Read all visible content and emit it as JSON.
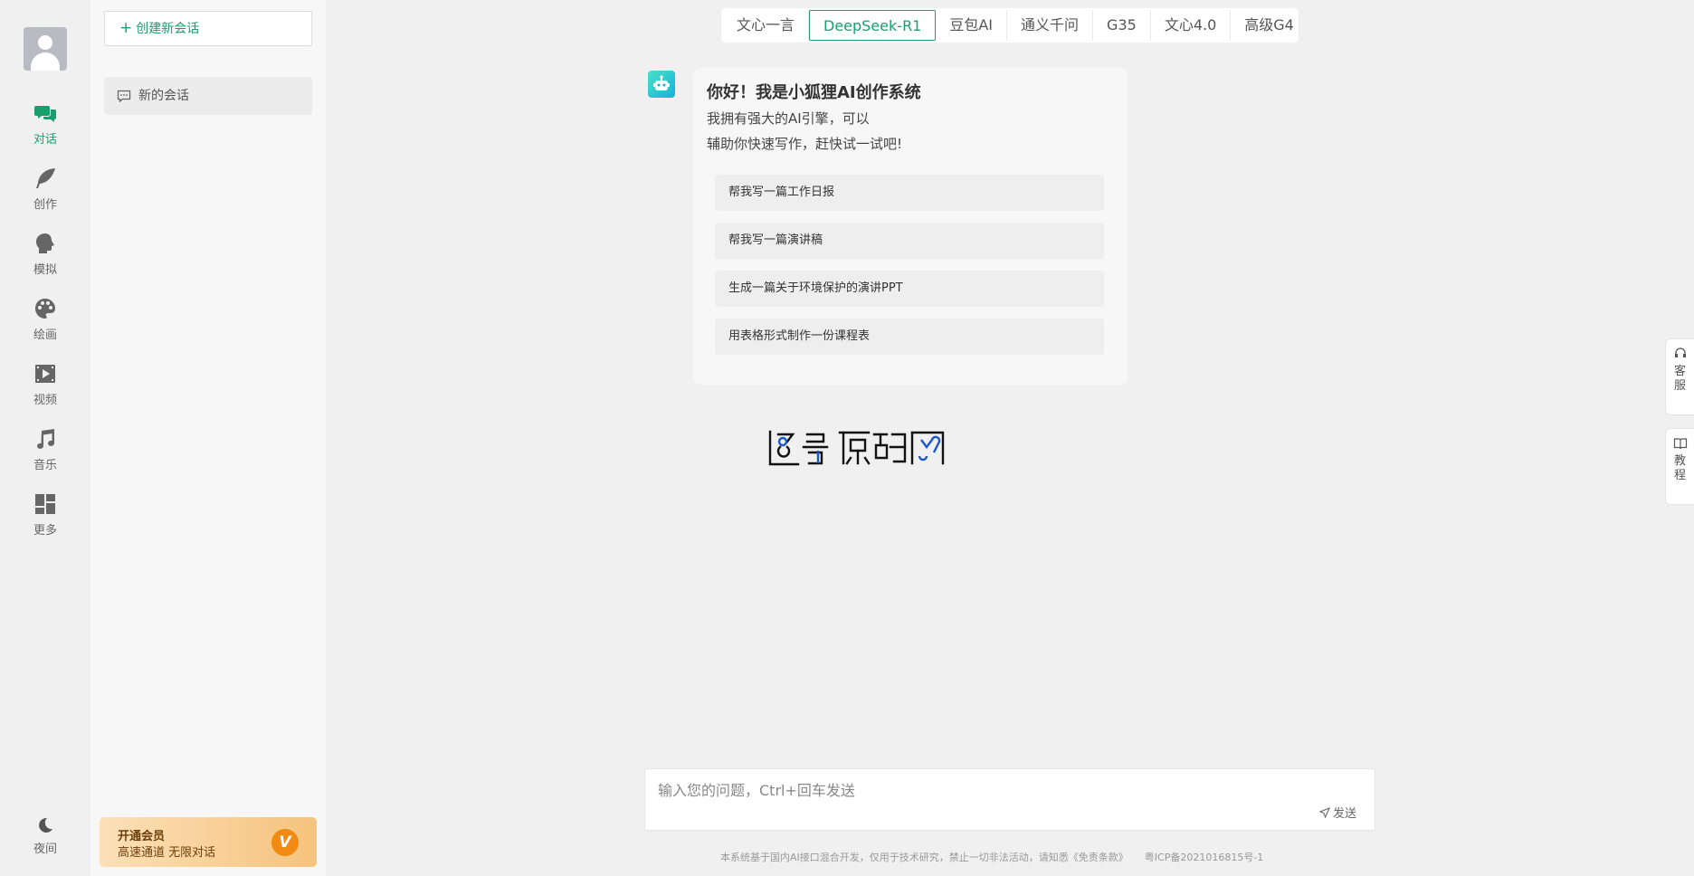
{
  "rail": {
    "items": [
      {
        "label": "对话",
        "icon": "chat-icon"
      },
      {
        "label": "创作",
        "icon": "feather-icon"
      },
      {
        "label": "模拟",
        "icon": "head-icon"
      },
      {
        "label": "绘画",
        "icon": "palette-icon"
      },
      {
        "label": "视频",
        "icon": "video-icon"
      },
      {
        "label": "音乐",
        "icon": "music-icon"
      },
      {
        "label": "更多",
        "icon": "grid-icon"
      }
    ],
    "night_label": "夜间"
  },
  "sidebar": {
    "new_chat_label": "创建新会话",
    "conversations": [
      {
        "title": "新的会话"
      }
    ],
    "member": {
      "title": "开通会员",
      "subtitle": "高速通道 无限对话",
      "badge": "V"
    }
  },
  "models": {
    "tabs": [
      "文心一言",
      "DeepSeek-R1",
      "豆包AI",
      "通义千问",
      "G35",
      "文心4.0",
      "高级G4"
    ],
    "active": "DeepSeek-R1"
  },
  "welcome": {
    "title": "你好！我是小狐狸AI创作系统",
    "line1": "我拥有强大的AI引擎，可以",
    "line2": "辅助你快速写作，赶快试一试吧!",
    "prompts": [
      "帮我写一篇工作日报",
      "帮我写一篇演讲稿",
      "生成一篇关于环境保护的演讲PPT",
      "用表格形式制作一份课程表"
    ]
  },
  "watermark": {
    "text": "图宗源码网"
  },
  "float": {
    "service": "客服",
    "tutorial": "教程"
  },
  "input": {
    "placeholder": "输入您的问题，Ctrl+回车发送",
    "send_label": "发送"
  },
  "footer": {
    "disclaimer": "本系统基于国内AI接口混合开发，仅用于技术研究，禁止一切非法活动，请知悉《免责条款》",
    "icp": "粤ICP备2021016815号-1"
  },
  "colors": {
    "accent": "#1a9e6e",
    "member_bg": "#f5c37d",
    "bot_avatar": "#16b2d8"
  }
}
